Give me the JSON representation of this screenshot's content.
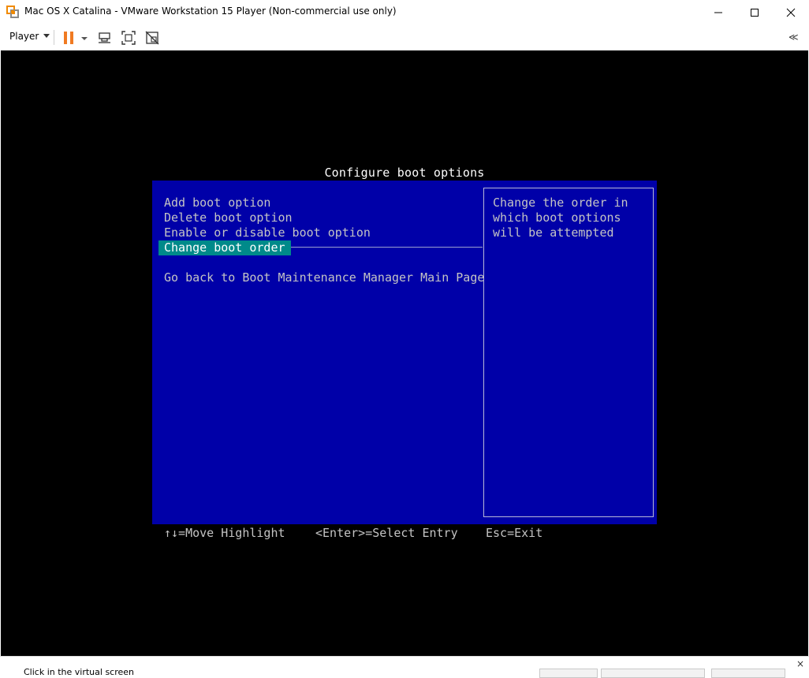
{
  "window": {
    "title": "Mac OS X Catalina - VMware Workstation 15 Player (Non-commercial use only)"
  },
  "toolbar": {
    "player_label": "Player",
    "icons": [
      "pause-icon",
      "dropdown-arrow-icon",
      "send-ctrl-alt-del-icon",
      "fit-guest-icon",
      "unity-icon",
      "collapse-toolbar-icon"
    ],
    "collapse_glyph": "≪"
  },
  "bios": {
    "title": "Configure boot options",
    "menu_items": [
      "Add boot option",
      "Delete boot option",
      "Enable or disable boot option",
      "Change boot order",
      "Go back to Boot Maintenance Manager Main Page"
    ],
    "selected_index": 3,
    "help_text": "Change the order in\nwhich boot options\nwill be attempted",
    "footer": {
      "move": "↑↓=Move Highlight",
      "select": "<Enter>=Select Entry",
      "exit": "Esc=Exit"
    }
  },
  "statusbar": {
    "text": "Click in the virtual screen",
    "close_glyph": "×"
  },
  "colors": {
    "bios_bg": "#0000a8",
    "highlight": "#008a8a",
    "pause_orange": "#f07a22"
  }
}
